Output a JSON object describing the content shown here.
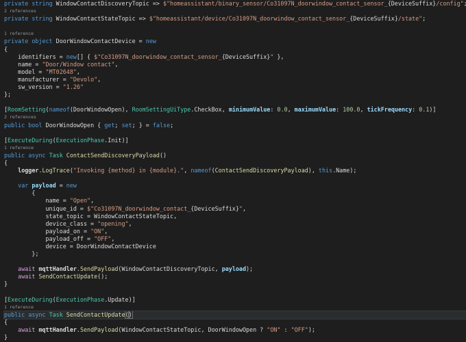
{
  "code": {
    "l1": [
      "private",
      " ",
      "string",
      " ",
      "WindowContactDiscoveryTopic",
      " => ",
      "$\"homeassistant/binary_sensor/Co31097N_doorwindow_contact_sensor_",
      "{DeviceSuffix}",
      "/config\"",
      ";"
    ],
    "l2": "2 references",
    "l3": [
      "private",
      " ",
      "string",
      " ",
      "WindowContactStateTopic",
      " => ",
      "$\"homeassistant/device/Co31097N_doorwindow_contact_sensor_",
      "{DeviceSuffix}",
      "/state\"",
      ";"
    ],
    "l4": "",
    "l5": "1 reference",
    "l6": [
      "private",
      " ",
      "object",
      " ",
      "DoorWindowContactDevice",
      " = ",
      "new"
    ],
    "l7": "{",
    "l8": [
      "    identifiers",
      " = ",
      "new",
      "[] { ",
      "$\"Co31097N_doorwindow_contact_sensor_",
      "{DeviceSuffix}",
      "\"",
      " },"
    ],
    "l9": [
      "    name",
      " = ",
      "\"Door/Window contact\"",
      ","
    ],
    "l10": [
      "    model",
      " = ",
      "\"MT02648\"",
      ","
    ],
    "l11": [
      "    manufacturer",
      " = ",
      "\"Devolo\"",
      ","
    ],
    "l12": [
      "    sw_version",
      " = ",
      "\"1.26\""
    ],
    "l13": "};",
    "l14": "",
    "l15": [
      "[",
      "RoomSetting",
      "(",
      "nameof",
      "(",
      "DoorWindowOpen",
      "), ",
      "RoomSettingUiType",
      ".",
      "CheckBox",
      ", ",
      "minimumValue",
      ": ",
      "0.0",
      ", ",
      "maximumValue",
      ": ",
      "100.0",
      ", ",
      "tickFrequency",
      ": ",
      "0.1",
      ")]"
    ],
    "l16": "2 references",
    "l17": [
      "public",
      " ",
      "bool",
      " ",
      "DoorWindowOpen",
      " { ",
      "get",
      "; ",
      "set",
      "; } = ",
      "false",
      ";"
    ],
    "l18": "",
    "l19": [
      "[",
      "ExecuteDuring",
      "(",
      "ExecutionPhase",
      ".",
      "Init",
      ")]"
    ],
    "l20": "1 reference",
    "l21": [
      "public",
      " ",
      "async",
      " ",
      "Task",
      " ",
      "ContactSendDiscoveryPayload",
      "()"
    ],
    "l22": "{",
    "l23": [
      "    ",
      "logger",
      ".",
      "LogTrace",
      "(",
      "\"Invoking {method} in {module}.\"",
      ", ",
      "nameof",
      "(",
      "ContactSendDiscoveryPayload",
      "), ",
      "this",
      ".",
      "Name",
      ");"
    ],
    "l24": "",
    "l25": [
      "    ",
      "var",
      " ",
      "payload",
      " = ",
      "new"
    ],
    "l26": "        {",
    "l27": [
      "            name",
      " = ",
      "\"Open\"",
      ","
    ],
    "l28": [
      "            unique_id",
      " = ",
      "$\"Co31097N_doorwindow_contact_",
      "{DeviceSuffix}",
      "\"",
      ","
    ],
    "l29": [
      "            state_topic",
      " = ",
      "WindowContactStateTopic",
      ","
    ],
    "l30": [
      "            device_class",
      " = ",
      "\"opening\"",
      ","
    ],
    "l31": [
      "            payload_on",
      " = ",
      "\"ON\"",
      ","
    ],
    "l32": [
      "            payload_off",
      " = ",
      "\"OFF\"",
      ","
    ],
    "l33": [
      "            device",
      " = ",
      "DoorWindowContactDevice"
    ],
    "l34": "        };",
    "l35": "",
    "l36": [
      "    ",
      "await",
      " ",
      "mqttHandler",
      ".",
      "SendPayload",
      "(",
      "WindowContactDiscoveryTopic",
      ", ",
      "payload",
      ");"
    ],
    "l37": [
      "    ",
      "await",
      " ",
      "SendContactUpdate",
      "();"
    ],
    "l38": "}",
    "l39": "",
    "l40": [
      "[",
      "ExecuteDuring",
      "(",
      "ExecutionPhase",
      ".",
      "Update",
      ")]"
    ],
    "l41": "1 reference",
    "l42": [
      "public",
      " ",
      "async",
      " ",
      "Task",
      " ",
      "SendContactUpdate",
      "(",
      ")"
    ],
    "l43": "{",
    "l44": [
      "    ",
      "await",
      " ",
      "mqttHandler",
      ".",
      "SendPayload",
      "(",
      "WindowContactStateTopic",
      ", ",
      "DoorWindowOpen",
      " ? ",
      "\"ON\"",
      " : ",
      "\"OFF\"",
      ");"
    ],
    "l45": "}"
  },
  "colors": {
    "background": "#1e1e1e",
    "keyword": "#569cd6",
    "control_keyword": "#d8a0df",
    "type": "#4ec9b0",
    "method": "#dcdcaa",
    "string": "#d69d85",
    "number": "#b5cea8",
    "codelens": "#999999"
  }
}
